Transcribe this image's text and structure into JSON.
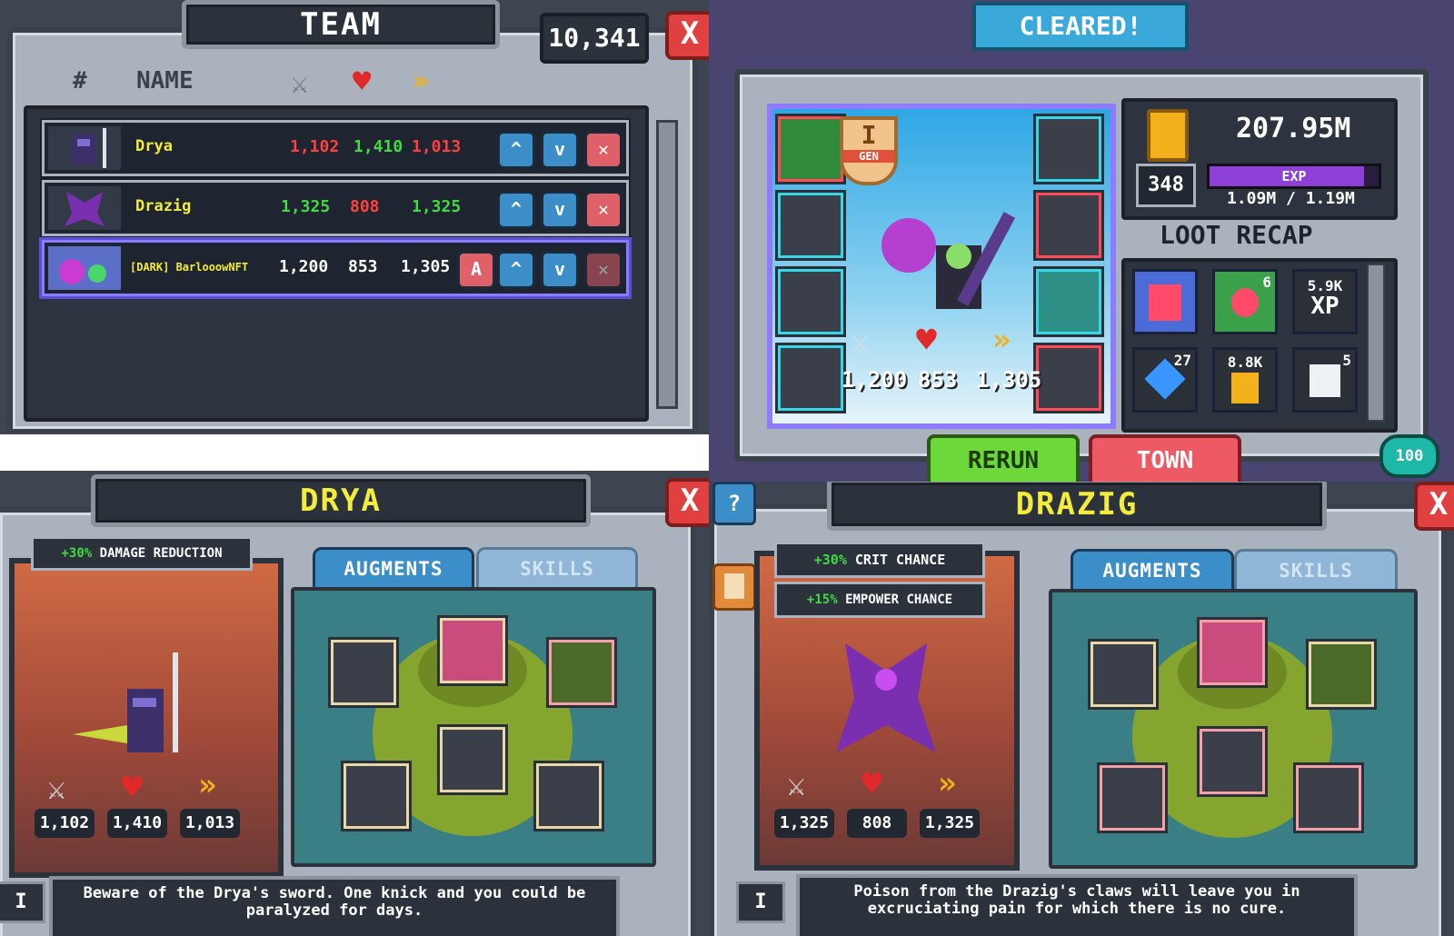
{
  "team": {
    "title": "TEAM",
    "score": "10,341",
    "close": "X",
    "headers": {
      "index": "#",
      "name": "NAME"
    },
    "rows": [
      {
        "name": "Drya",
        "atk": "1,102",
        "hp": "1,410",
        "spd": "1,013"
      },
      {
        "name": "Drazig",
        "atk": "1,325",
        "hp": "808",
        "spd": "1,325"
      },
      {
        "name": "[DARK] BarlooowNFT",
        "atk": "1,200",
        "hp": "853",
        "spd": "1,305",
        "a_label": "A"
      }
    ]
  },
  "cleared": {
    "banner": "CLEARED!",
    "gen_label": "GEN",
    "gen_value": "I",
    "gold": "207.95M",
    "level": "348",
    "exp_label": "EXP",
    "exp_progress": "1.09M / 1.19M",
    "exp_fraction": 0.916,
    "loot_title": "LOOT RECAP",
    "stats": {
      "atk": "1,200",
      "hp": "853",
      "spd": "1,305"
    },
    "loot": [
      {
        "count": "",
        "kind": "potion-jar-icon"
      },
      {
        "count": "6",
        "kind": "potion-flask-icon"
      },
      {
        "count": "5.9K",
        "kind": "xp-icon",
        "xp": "XP"
      },
      {
        "count": "27",
        "kind": "gem-icon"
      },
      {
        "count": "8.8K",
        "kind": "gold-icon"
      },
      {
        "count": "5",
        "kind": "scroll-icon"
      }
    ],
    "rerun": "RERUN",
    "town": "TOWN",
    "energy": "100"
  },
  "drya": {
    "title": "DRYA",
    "bonus_value": "+30%",
    "bonus_text": "DAMAGE REDUCTION",
    "tab_augments": "AUGMENTS",
    "tab_skills": "SKILLS",
    "atk": "1,102",
    "hp": "1,410",
    "spd": "1,013",
    "level": "I",
    "desc": "Beware of the Drya's sword. One knick and you could be paralyzed for days."
  },
  "drazig": {
    "title": "DRAZIG",
    "help": "?",
    "bonus1_value": "+30%",
    "bonus1_text": "CRIT CHANCE",
    "bonus2_value": "+15%",
    "bonus2_text": "EMPOWER CHANCE",
    "tab_augments": "AUGMENTS",
    "tab_skills": "SKILLS",
    "atk": "1,325",
    "hp": "808",
    "spd": "1,325",
    "level": "I",
    "desc": "Poison from the Drazig's claws will leave you in excruciating pain for which there is no cure."
  },
  "colors": {
    "atk": "#ff4040",
    "hp": "#43d943",
    "yellow": "#f3ec3c",
    "accent_purple": "#8d3fd8"
  }
}
